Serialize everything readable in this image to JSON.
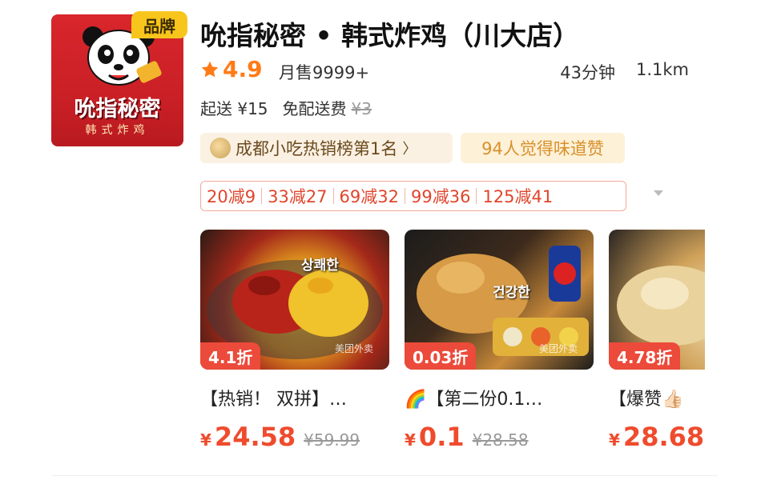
{
  "store": {
    "logo_name": "吮指秘密",
    "logo_sub": "韩式炸鸡",
    "brand_badge": "品牌",
    "title": "吮指秘密 • 韩式炸鸡（川大店）",
    "rating": "4.9",
    "sales": "月售9999+",
    "eta": "43分钟",
    "distance": "1.1km",
    "min_order": "起送 ¥15",
    "delivery": "免配送费",
    "delivery_orig": "¥3",
    "rank_badge": "成都小吃热销榜第1名",
    "rank_chevron": "〉",
    "taste_badge": "94人觉得味道赞",
    "accent_color": "#ff7b18",
    "price_color": "#ef4b2d"
  },
  "coupons": [
    "20减9",
    "33减27",
    "69减32",
    "99减36",
    "125减41"
  ],
  "products": [
    {
      "discount": "4.1折",
      "name": "【热销！ 双拼】…",
      "price": "24.58",
      "orig": "¥59.99",
      "yen": "¥",
      "korean": "상쾌한",
      "watermark": "美团外卖"
    },
    {
      "discount": "0.03折",
      "name": "🌈【第二份0.1…",
      "price": "0.1",
      "orig": "¥28.58",
      "yen": "¥",
      "korean": "건강한",
      "watermark": "美团外卖"
    },
    {
      "discount": "4.78折",
      "name": "【爆赞👍🏻",
      "price": "28.68",
      "orig": "",
      "yen": "¥",
      "korean": "",
      "watermark": ""
    }
  ]
}
